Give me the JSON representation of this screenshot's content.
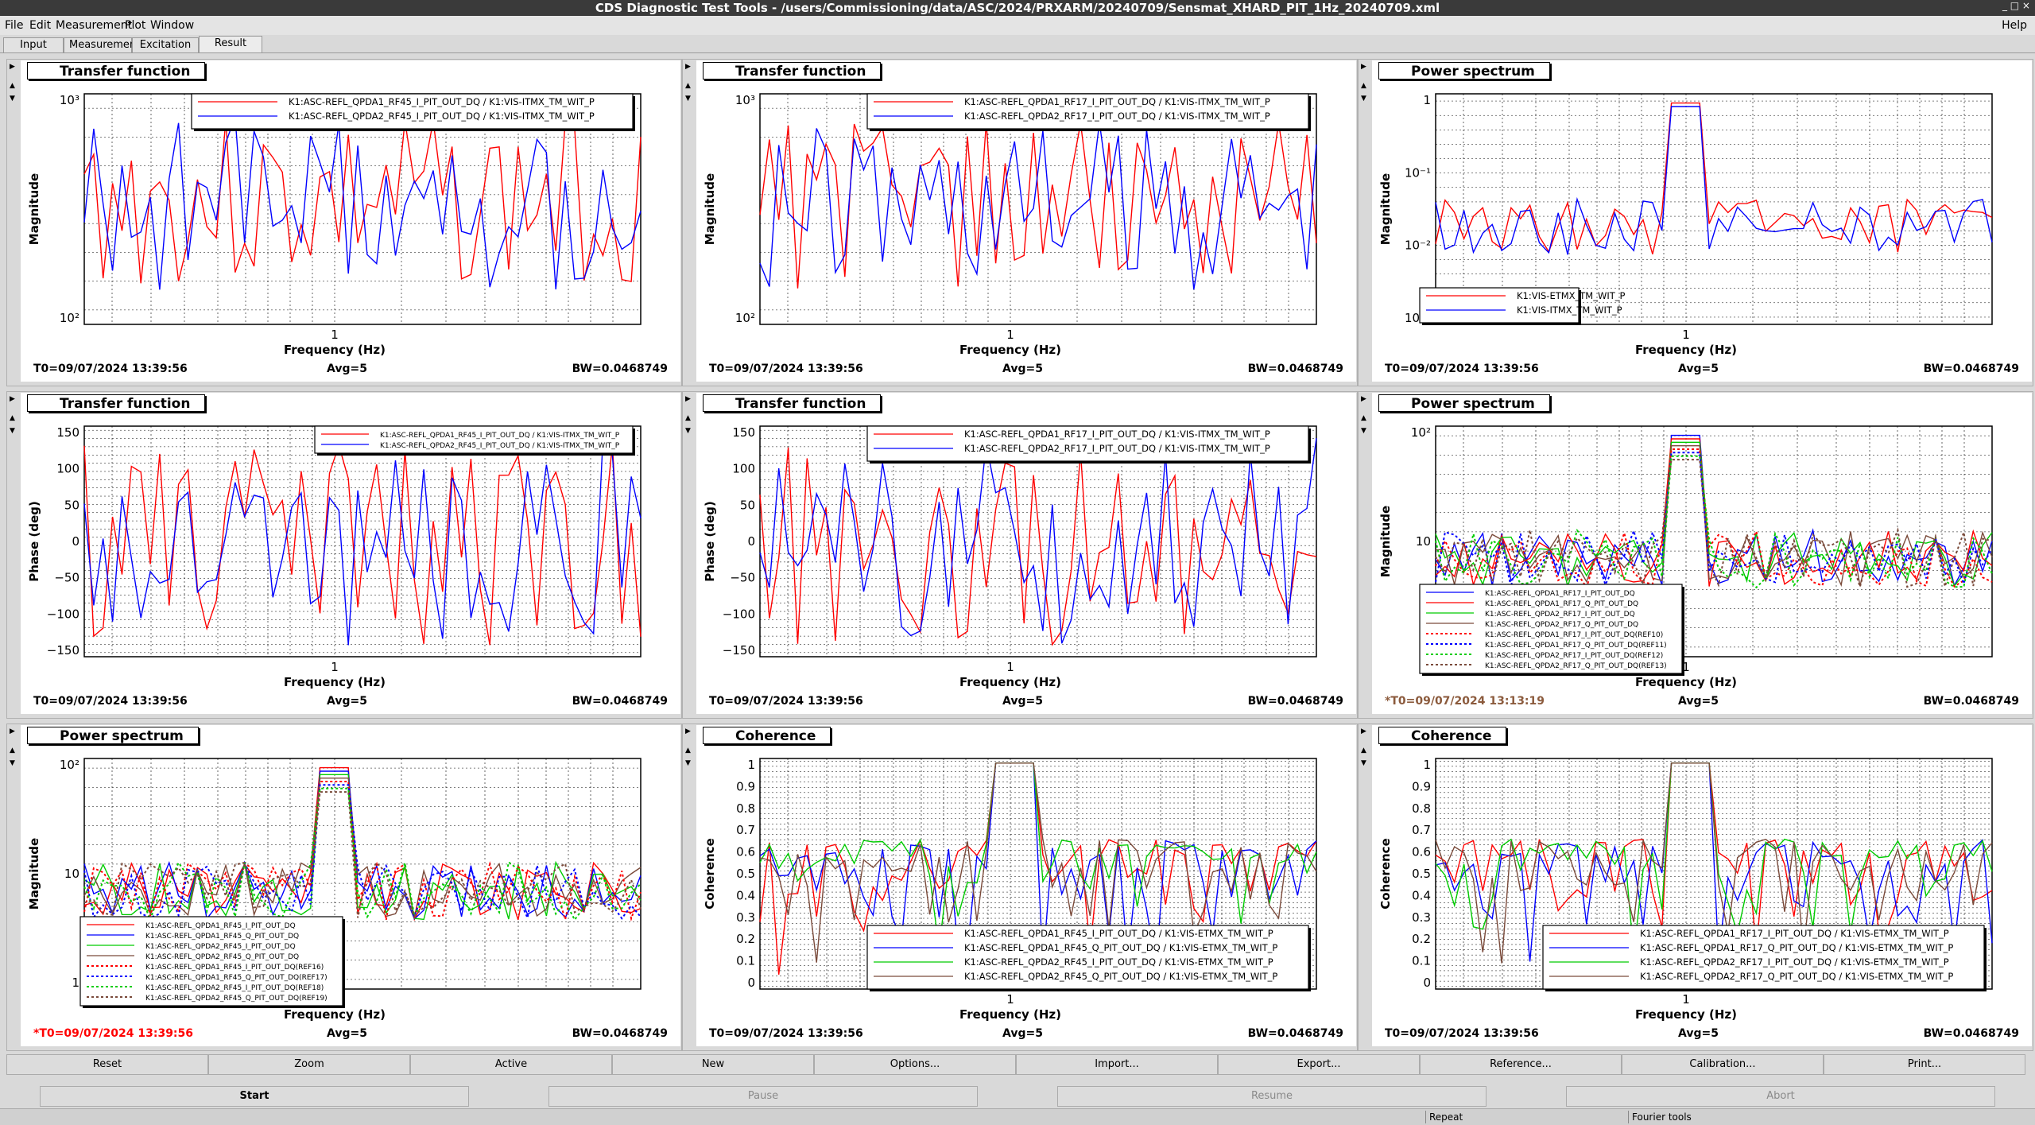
{
  "window": {
    "title": "CDS Diagnostic Test Tools - /users/Commissioning/data/ASC/2024/PRXARM/20240709/Sensmat_XHARD_PIT_1Hz_20240709.xml",
    "controls": "_ □ ×"
  },
  "menu": {
    "file": "File",
    "edit": "Edit",
    "measurement": "Measurement",
    "plot": "Plot",
    "window": "Window",
    "help": "Help"
  },
  "tabs": [
    "Input",
    "Measurement",
    "Excitation",
    "Result"
  ],
  "panels": [
    {
      "title": "Transfer function",
      "ylabel": "Magnitude",
      "xlabel": "Frequency (Hz)",
      "yticks": [
        "10³",
        "10²"
      ],
      "xtick": "1",
      "t0": "T0=09/07/2024 13:39:56",
      "avg": "Avg=5",
      "bw": "BW=0.0468749",
      "legend": [
        "K1:ASC-REFL_QPDA1_RF45_I_PIT_OUT_DQ / K1:VIS-ITMX_TM_WIT_P",
        "K1:ASC-REFL_QPDA2_RF45_I_PIT_OUT_DQ / K1:VIS-ITMX_TM_WIT_P"
      ]
    },
    {
      "title": "Transfer function",
      "ylabel": "Magnitude",
      "xlabel": "Frequency (Hz)",
      "yticks": [
        "10³",
        "10²"
      ],
      "xtick": "1",
      "t0": "T0=09/07/2024 13:39:56",
      "avg": "Avg=5",
      "bw": "BW=0.0468749",
      "legend": [
        "K1:ASC-REFL_QPDA1_RF17_I_PIT_OUT_DQ / K1:VIS-ITMX_TM_WIT_P",
        "K1:ASC-REFL_QPDA2_RF17_I_PIT_OUT_DQ / K1:VIS-ITMX_TM_WIT_P"
      ]
    },
    {
      "title": "Power spectrum",
      "ylabel": "Magnitude",
      "xlabel": "Frequency (Hz)",
      "yticks": [
        "1",
        "10⁻¹",
        "10⁻²",
        "10⁻³"
      ],
      "xtick": "1",
      "t0": "T0=09/07/2024 13:39:56",
      "avg": "Avg=5",
      "bw": "BW=0.0468749",
      "legend": [
        "K1:VIS-ETMX_TM_WIT_P",
        "K1:VIS-ITMX_TM_WIT_P"
      ]
    },
    {
      "title": "Transfer function",
      "ylabel": "Phase (deg)",
      "xlabel": "Frequency (Hz)",
      "yticks": [
        "150",
        "100",
        "50",
        "0",
        "−50",
        "−100",
        "−150"
      ],
      "xtick": "1",
      "t0": "T0=09/07/2024 13:39:56",
      "avg": "Avg=5",
      "bw": "BW=0.0468749",
      "legend": [
        "K1:ASC-REFL_QPDA1_RF45_I_PIT_OUT_DQ / K1:VIS-ITMX_TM_WIT_P",
        "K1:ASC-REFL_QPDA2_RF45_I_PIT_OUT_DQ / K1:VIS-ITMX_TM_WIT_P"
      ]
    },
    {
      "title": "Transfer function",
      "ylabel": "Phase (deg)",
      "xlabel": "Frequency (Hz)",
      "yticks": [
        "150",
        "100",
        "50",
        "0",
        "−50",
        "−100",
        "−150"
      ],
      "xtick": "1",
      "t0": "T0=09/07/2024 13:39:56",
      "avg": "Avg=5",
      "bw": "BW=0.0468749",
      "legend": [
        "K1:ASC-REFL_QPDA1_RF17_I_PIT_OUT_DQ / K1:VIS-ITMX_TM_WIT_P",
        "K1:ASC-REFL_QPDA2_RF17_I_PIT_OUT_DQ / K1:VIS-ITMX_TM_WIT_P"
      ]
    },
    {
      "title": "Power spectrum",
      "ylabel": "Magnitude",
      "xlabel": "Frequency (Hz)",
      "yticks": [
        "10²",
        "10",
        "1"
      ],
      "xtick": "1",
      "t0": "*T0=09/07/2024 13:13:19",
      "avg": "Avg=5",
      "bw": "BW=0.0468749",
      "legend": [
        "K1:ASC-REFL_QPDA1_RF17_I_PIT_OUT_DQ",
        "K1:ASC-REFL_QPDA1_RF17_Q_PIT_OUT_DQ",
        "K1:ASC-REFL_QPDA2_RF17_I_PIT_OUT_DQ",
        "K1:ASC-REFL_QPDA2_RF17_Q_PIT_OUT_DQ",
        "K1:ASC-REFL_QPDA1_RF17_I_PIT_OUT_DQ(REF10)",
        "K1:ASC-REFL_QPDA1_RF17_Q_PIT_OUT_DQ(REF11)",
        "K1:ASC-REFL_QPDA2_RF17_I_PIT_OUT_DQ(REF12)",
        "K1:ASC-REFL_QPDA2_RF17_Q_PIT_OUT_DQ(REF13)"
      ]
    },
    {
      "title": "Power spectrum",
      "ylabel": "Magnitude",
      "xlabel": "Frequency (Hz)",
      "yticks": [
        "10²",
        "10",
        "1"
      ],
      "xtick": "1",
      "t0": "*T0=09/07/2024 13:39:56",
      "avg": "Avg=5",
      "bw": "BW=0.0468749",
      "legend": [
        "K1:ASC-REFL_QPDA1_RF45_I_PIT_OUT_DQ",
        "K1:ASC-REFL_QPDA1_RF45_Q_PIT_OUT_DQ",
        "K1:ASC-REFL_QPDA2_RF45_I_PIT_OUT_DQ",
        "K1:ASC-REFL_QPDA2_RF45_Q_PIT_OUT_DQ",
        "K1:ASC-REFL_QPDA1_RF45_I_PIT_OUT_DQ(REF16)",
        "K1:ASC-REFL_QPDA1_RF45_Q_PIT_OUT_DQ(REF17)",
        "K1:ASC-REFL_QPDA2_RF45_I_PIT_OUT_DQ(REF18)",
        "K1:ASC-REFL_QPDA2_RF45_Q_PIT_OUT_DQ(REF19)"
      ]
    },
    {
      "title": "Coherence",
      "ylabel": "Coherence",
      "xlabel": "Frequency (Hz)",
      "yticks": [
        "1",
        "0.9",
        "0.8",
        "0.7",
        "0.6",
        "0.5",
        "0.4",
        "0.3",
        "0.2",
        "0.1",
        "0"
      ],
      "xtick": "1",
      "t0": "T0=09/07/2024 13:39:56",
      "avg": "Avg=5",
      "bw": "BW=0.0468749",
      "legend": [
        "K1:ASC-REFL_QPDA1_RF45_I_PIT_OUT_DQ / K1:VIS-ETMX_TM_WIT_P",
        "K1:ASC-REFL_QPDA1_RF45_Q_PIT_OUT_DQ / K1:VIS-ETMX_TM_WIT_P",
        "K1:ASC-REFL_QPDA2_RF45_I_PIT_OUT_DQ / K1:VIS-ETMX_TM_WIT_P",
        "K1:ASC-REFL_QPDA2_RF45_Q_PIT_OUT_DQ / K1:VIS-ETMX_TM_WIT_P"
      ]
    },
    {
      "title": "Coherence",
      "ylabel": "Coherence",
      "xlabel": "Frequency (Hz)",
      "yticks": [
        "1",
        "0.9",
        "0.8",
        "0.7",
        "0.6",
        "0.5",
        "0.4",
        "0.3",
        "0.2",
        "0.1",
        "0"
      ],
      "xtick": "1",
      "t0": "T0=09/07/2024 13:39:56",
      "avg": "Avg=5",
      "bw": "BW=0.0468749",
      "legend": [
        "K1:ASC-REFL_QPDA1_RF17_I_PIT_OUT_DQ / K1:VIS-ETMX_TM_WIT_P",
        "K1:ASC-REFL_QPDA1_RF17_Q_PIT_OUT_DQ / K1:VIS-ETMX_TM_WIT_P",
        "K1:ASC-REFL_QPDA2_RF17_I_PIT_OUT_DQ / K1:VIS-ETMX_TM_WIT_P",
        "K1:ASC-REFL_QPDA2_RF17_Q_PIT_OUT_DQ / K1:VIS-ETMX_TM_WIT_P"
      ]
    }
  ],
  "series_colors": {
    "red": "#ff0000",
    "blue": "#0000ff",
    "green": "#00cc00",
    "brown": "#7a4a3a"
  },
  "t0_colors": {
    "normal": "#000000",
    "star_brown": "#8b5a3c",
    "star_red": "#ff0000"
  },
  "buttons_row1": [
    "Reset",
    "Zoom",
    "Active",
    "New",
    "Options...",
    "Import...",
    "Export...",
    "Reference...",
    "Calibration...",
    "Print..."
  ],
  "buttons_row2": {
    "start": "Start",
    "pause": "Pause",
    "resume": "Resume",
    "abort": "Abort"
  },
  "status": {
    "repeat": "Repeat",
    "fourier": "Fourier tools"
  }
}
